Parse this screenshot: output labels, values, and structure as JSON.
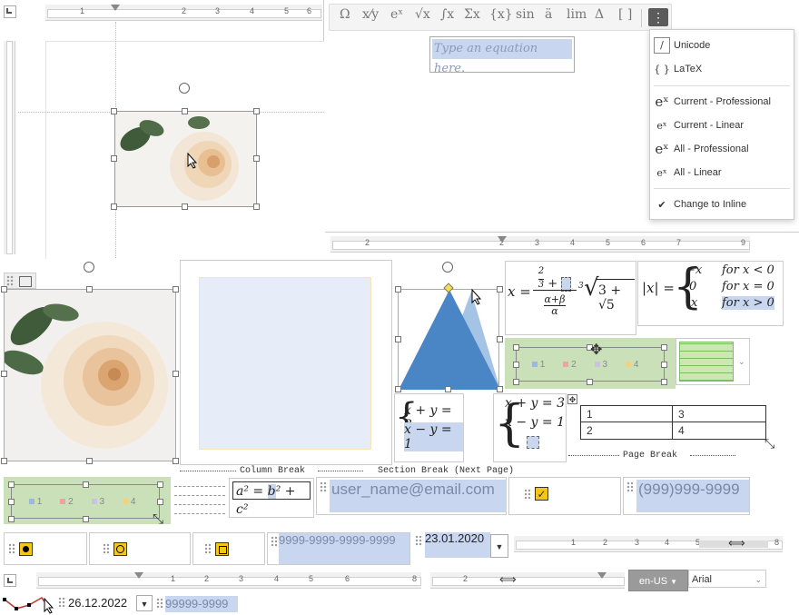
{
  "equation_toolbar": {
    "icons": [
      "omega-icon",
      "fraction-icon",
      "exponent-icon",
      "radical-icon",
      "integral-icon",
      "sum-icon",
      "brackets-icon",
      "function-icon",
      "accent-icon",
      "limit-icon",
      "operator-icon",
      "matrix-icon"
    ],
    "labels": [
      "Ω",
      "x⁄y",
      "eˣ",
      "√x",
      "∫x",
      "Σx",
      "{x}",
      "sin",
      "ä",
      "lim",
      "Δ",
      "[ ]"
    ],
    "more_icon": "more-vertical-icon"
  },
  "equation_placeholder": "Type an equation here.",
  "equation_menu": {
    "items": [
      {
        "icon": "/",
        "label": "Unicode"
      },
      {
        "icon": "{ }",
        "label": "LaTeX"
      },
      {
        "icon": "eˣ",
        "label": "Current - Professional"
      },
      {
        "icon": "eˣ",
        "label": "Current - Linear"
      },
      {
        "icon": "eˣ",
        "label": "All - Professional"
      },
      {
        "icon": "eˣ",
        "label": "All - Linear"
      },
      {
        "icon": "✔",
        "label": "Change to Inline"
      }
    ]
  },
  "ruler_numbers": [
    "1",
    "2",
    "3",
    "4",
    "5",
    "6"
  ],
  "ruler2_numbers": [
    "2",
    "1",
    "1",
    "2",
    "3",
    "4",
    "5",
    "6",
    "7",
    "8",
    "9"
  ],
  "breaks": {
    "column_break": "Column Break",
    "section_break": "Section Break (Next Page)",
    "page_break": "Page Break"
  },
  "chart_legend": [
    "1",
    "2",
    "3",
    "4"
  ],
  "chart_legend_colors": [
    "#9db8e0",
    "#f0a3a3",
    "#c9c3e0",
    "#f5d27a"
  ],
  "table": {
    "rows": [
      [
        "1",
        "3"
      ],
      [
        "2",
        "4"
      ]
    ]
  },
  "fields": {
    "email": "user_name@email.com",
    "phone": "(999)999-9999",
    "card": "9999-9999-9999-9999",
    "date1": "23.01.2020",
    "date2": "26.12.2022",
    "zip": "99999-9999"
  },
  "equations": {
    "eq_sys1_line1": "x + y = 3",
    "eq_sys1_line2": "x − y = 1",
    "eq_sys2_line1": "x + y = 3",
    "eq_sys2_line2": "x − y = 1",
    "abs_lhs": "|x| =",
    "abs_cases": [
      [
        "−x",
        "for x < 0"
      ],
      [
        "0",
        "for x = 0"
      ],
      [
        "x",
        "for x > 0"
      ]
    ],
    "frac_eq": "x ="
  },
  "statusbar": {
    "language": "en-US",
    "font": "Arial"
  },
  "colors": {
    "accent_selection": "#c8d6ef",
    "chart_bg": "#c9e0b9",
    "shape_blue": "#4a86c5",
    "checkbox_yellow": "#f5c518"
  }
}
